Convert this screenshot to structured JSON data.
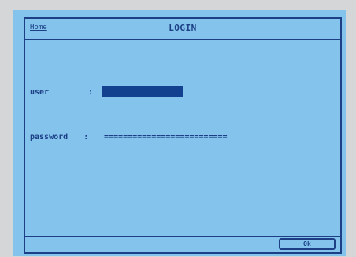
{
  "window": {
    "menu_label": "Home",
    "title": "LOGIN"
  },
  "form": {
    "user_label": "user",
    "user_separator": ":",
    "password_label": "password",
    "password_separator": ":",
    "password_mask": "=========================="
  },
  "actions": {
    "ok_label": "Ok"
  },
  "colors": {
    "screen_bg": "#83c3ec",
    "ink": "#1c3f86",
    "input_fill": "#13408f"
  }
}
